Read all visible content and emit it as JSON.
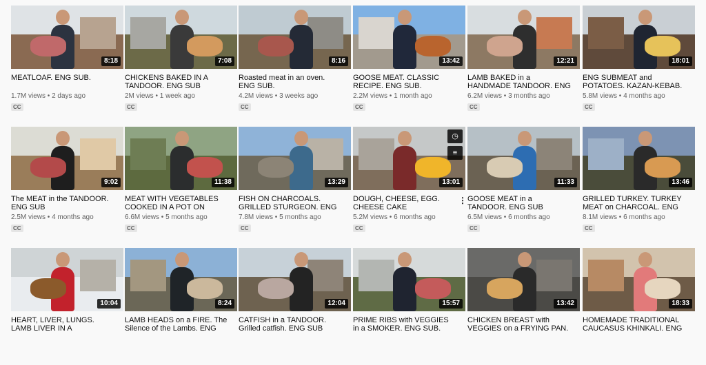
{
  "colors": {
    "duration_bg": "#000000",
    "title_text": "#0f0f0f",
    "meta_text": "#606060",
    "badge_bg": "#e5e5e5"
  },
  "videos": [
    {
      "title": "MEATLOAF. ENG SUB.",
      "views": "1.7M views",
      "age": "2 days ago",
      "duration": "8:18",
      "badge": "CC",
      "theme": {
        "sky": "#dfe3e6",
        "ground": "#8a6a52",
        "wall": "#b7a390",
        "shirt": "#2c3340",
        "food": "#c0696a"
      }
    },
    {
      "title": "CHICKENS BAKED IN A TANDOOR. ENG SUB",
      "views": "2M views",
      "age": "1 week ago",
      "duration": "7:08",
      "badge": "CC",
      "theme": {
        "sky": "#cfd9de",
        "ground": "#6c6a48",
        "wall": "#a7a7a2",
        "shirt": "#3a3a3a",
        "food": "#d39a5e"
      }
    },
    {
      "title": "Roasted meat in an oven. ENG SUB.",
      "views": "4.2M views",
      "age": "3 weeks ago",
      "duration": "8:16",
      "badge": "CC",
      "theme": {
        "sky": "#bfcbd2",
        "ground": "#76664f",
        "wall": "#8e8c86",
        "shirt": "#242a36",
        "food": "#a8574d"
      }
    },
    {
      "title": "GOOSE MEAT. CLASSIC RECIPE. ENG SUB.",
      "views": "2.2M views",
      "age": "1 month ago",
      "duration": "13:42",
      "badge": "CC",
      "theme": {
        "sky": "#7fb1e3",
        "ground": "#a29a8e",
        "wall": "#d9d5cf",
        "shirt": "#20283a",
        "food": "#b9642e"
      }
    },
    {
      "title": "LAMB BAKED in a HANDMADE TANDOOR. ENG SUB",
      "views": "6.2M views",
      "age": "3 months ago",
      "duration": "12:21",
      "badge": "CC",
      "theme": {
        "sky": "#d8dde0",
        "ground": "#8d7963",
        "wall": "#c77a52",
        "shirt": "#2e2e2e",
        "food": "#cfa48e"
      }
    },
    {
      "title": "ENG SUBMEAT and POTATOES. KAZAN-KEBAB. ENG SUB",
      "views": "5.8M views",
      "age": "4 months ago",
      "duration": "18:01",
      "badge": "CC",
      "theme": {
        "sky": "#c9cfd4",
        "ground": "#5f4a3b",
        "wall": "#7b5d46",
        "shirt": "#1f2532",
        "food": "#e6c25a"
      }
    },
    {
      "title": "The MEAT in the TANDOOR. ENG SUB",
      "views": "2.5M views",
      "age": "4 months ago",
      "duration": "9:02",
      "badge": "CC",
      "theme": {
        "sky": "#dcdcd4",
        "ground": "#9a7d5a",
        "wall": "#e0c9a6",
        "shirt": "#1e1e1e",
        "food": "#b34a4a"
      }
    },
    {
      "title": "MEAT WITH VEGETABLES COOKED IN A POT ON OPEN FIRE",
      "views": "6.6M views",
      "age": "5 months ago",
      "duration": "11:38",
      "badge": "CC",
      "theme": {
        "sky": "#8fa483",
        "ground": "#5d6a3f",
        "wall": "#6e7d54",
        "shirt": "#2b2d2e",
        "food": "#c2524d"
      }
    },
    {
      "title": "FISH ON CHARCOALS. GRILLED STURGEON. ENG SUB",
      "views": "7.8M views",
      "age": "5 months ago",
      "duration": "13:29",
      "badge": "CC",
      "theme": {
        "sky": "#8fb3d8",
        "ground": "#6f6a5c",
        "wall": "#b9b2a6",
        "shirt": "#3d6a8c",
        "food": "#8c8476"
      }
    },
    {
      "title": "DOUGH, CHEESE, EGG. CHEESE CAKE \"KHACHAPURI\"",
      "views": "5.2M views",
      "age": "6 months ago",
      "duration": "13:01",
      "badge": "CC",
      "theme": {
        "sky": "#c5c8c8",
        "ground": "#7f6e5c",
        "wall": "#a9a39a",
        "shirt": "#7a2a2a",
        "food": "#f0b52a"
      },
      "hover": true
    },
    {
      "title": "GOOSE MEAT in a TANDOOR. ENG SUB",
      "views": "6.5M views",
      "age": "6 months ago",
      "duration": "11:33",
      "badge": "CC",
      "theme": {
        "sky": "#b6c0c6",
        "ground": "#6b6253",
        "wall": "#8c8478",
        "shirt": "#2d6db2",
        "food": "#d8cbb3"
      }
    },
    {
      "title": "GRILLED TURKEY. TURKEY MEAT on CHARCOAL. ENG SUB",
      "views": "8.1M views",
      "age": "6 months ago",
      "duration": "13:46",
      "badge": "CC",
      "theme": {
        "sky": "#7d93b3",
        "ground": "#4a4c3a",
        "wall": "#9db0c7",
        "shirt": "#2a2a2a",
        "food": "#d89a52"
      }
    },
    {
      "title": "HEART, LIVER, LUNGS. LAMB LIVER IN A CAULDRON. ENG SUB",
      "views": "",
      "age": "",
      "duration": "10:04",
      "badge": "",
      "theme": {
        "sky": "#cfd4d6",
        "ground": "#e9ecef",
        "wall": "#b5b1a8",
        "shirt": "#c2222c",
        "food": "#8b5a2b"
      }
    },
    {
      "title": "LAMB HEADS on a FIRE. The Silence of the Lambs. ENG SUB",
      "views": "",
      "age": "",
      "duration": "8:24",
      "badge": "",
      "theme": {
        "sky": "#8cb1d6",
        "ground": "#6b6757",
        "wall": "#a39780",
        "shirt": "#1f2428",
        "food": "#cbb89c"
      }
    },
    {
      "title": "CATFISH in a TANDOOR. Grilled catfish. ENG SUB",
      "views": "",
      "age": "",
      "duration": "12:04",
      "badge": "",
      "theme": {
        "sky": "#c7d1d8",
        "ground": "#6e6250",
        "wall": "#8e8478",
        "shirt": "#232323",
        "food": "#b9a7a0"
      }
    },
    {
      "title": "PRIME RIBS with VEGGIES in a SMOKER. ENG SUB.",
      "views": "",
      "age": "",
      "duration": "15:57",
      "badge": "",
      "theme": {
        "sky": "#d6dada",
        "ground": "#5f6b45",
        "wall": "#b3b6b2",
        "shirt": "#1f2430",
        "food": "#c45b5b"
      }
    },
    {
      "title": "CHICKEN BREAST with VEGGIES on a FRYING PAN. ENG SUB",
      "views": "",
      "age": "",
      "duration": "13:42",
      "badge": "",
      "theme": {
        "sky": "#6a6a68",
        "ground": "#4b4a46",
        "wall": "#7a7670",
        "shirt": "#2a2a2a",
        "food": "#d7a55e"
      }
    },
    {
      "title": "HOMEMADE TRADITIONAL CAUCASUS KHINKALI. ENG SUB",
      "views": "",
      "age": "",
      "duration": "18:33",
      "badge": "",
      "theme": {
        "sky": "#d2c3ad",
        "ground": "#6e5b47",
        "wall": "#b78a64",
        "shirt": "#e27a7a",
        "food": "#e6d6bf"
      }
    }
  ],
  "hover_icons": {
    "watch_later": "watch-later-icon",
    "add_to_queue": "add-to-queue-icon"
  },
  "menu_icon": "more-vert-icon"
}
